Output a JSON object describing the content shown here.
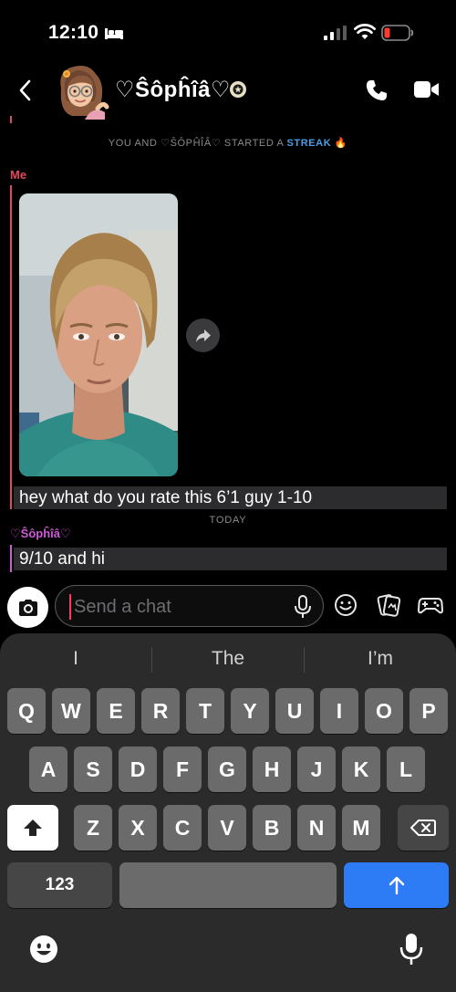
{
  "status_bar": {
    "time": "12:10"
  },
  "header": {
    "contact_name": "♡Ŝôpĥîâ♡"
  },
  "chat": {
    "streak_prefix": "YOU AND ♡ŜÔPĤÎÂ♡ STARTED A ",
    "streak_highlight": "STREAK",
    "streak_emoji": "🔥",
    "sender_me": "Me",
    "message_me": "hey what do you rate this 6’1 guy 1-10",
    "date_divider": "TODAY",
    "sender_other": "♡Ŝôpĥîâ♡",
    "message_other": "9/10 and hi"
  },
  "composer": {
    "placeholder": "Send a chat"
  },
  "keyboard": {
    "suggestions": [
      "I",
      "The",
      "I’m"
    ],
    "row1": [
      "Q",
      "W",
      "E",
      "R",
      "T",
      "Y",
      "U",
      "I",
      "O",
      "P"
    ],
    "row2": [
      "A",
      "S",
      "D",
      "F",
      "G",
      "H",
      "J",
      "K",
      "L"
    ],
    "row3": [
      "Z",
      "X",
      "C",
      "V",
      "B",
      "N",
      "M"
    ],
    "numbers_label": "123"
  },
  "colors": {
    "me": "#e4485f",
    "other": "#d05ad8",
    "streak": "#4a9fe8",
    "send_key": "#2d7cf6"
  }
}
